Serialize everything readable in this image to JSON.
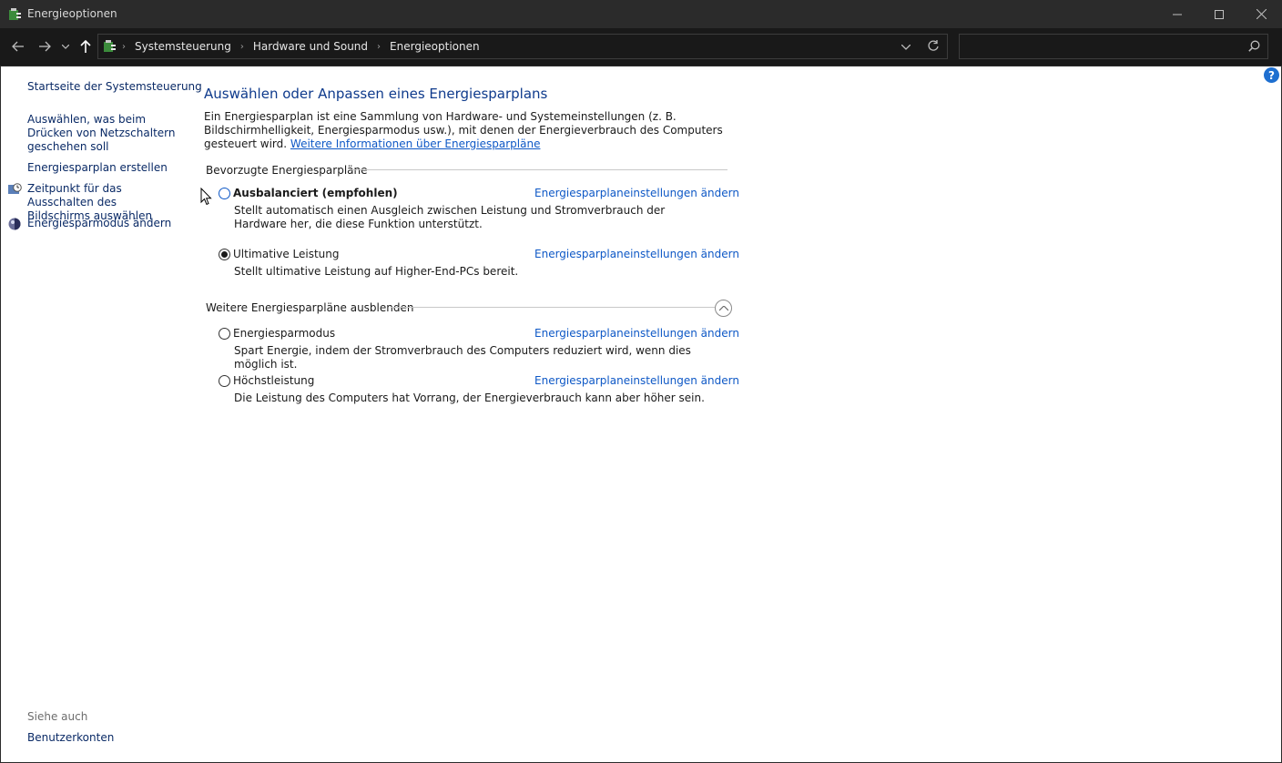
{
  "window": {
    "title": "Energieoptionen"
  },
  "nav": {
    "breadcrumbs": [
      "Systemsteuerung",
      "Hardware und Sound",
      "Energieoptionen"
    ],
    "search_placeholder": ""
  },
  "sidebar": {
    "home_link": "Startseite der Systemsteuerung",
    "links": [
      "Auswählen, was beim Drücken von Netzschaltern geschehen soll",
      "Energiesparplan erstellen",
      "Zeitpunkt für das Ausschalten des Bildschirms auswählen",
      "Energiesparmodus ändern"
    ],
    "see_also_label": "Siehe auch",
    "see_also_links": [
      "Benutzerkonten"
    ]
  },
  "main": {
    "title": "Auswählen oder Anpassen eines Energiesparplans",
    "intro_text": "Ein Energiesparplan ist eine Sammlung von Hardware- und Systemeinstellungen (z. B. Bildschirmhelligkeit, Energiesparmodus usw.), mit denen der Energieverbrauch des Computers gesteuert wird.",
    "intro_link": "Weitere Informationen über Energiesparpläne",
    "preferred_group_label": "Bevorzugte Energiesparpläne",
    "more_group_label": "Weitere Energiesparpläne ausblenden",
    "plans": [
      {
        "name": "Ausbalanciert (empfohlen)",
        "description": "Stellt automatisch einen Ausgleich zwischen Leistung und Stromverbrauch der Hardware her, die diese Funktion unterstützt.",
        "link": "Energiesparplaneinstellungen ändern",
        "selected": false
      },
      {
        "name": "Ultimative Leistung",
        "description": "Stellt ultimative Leistung auf Higher-End-PCs bereit.",
        "link": "Energiesparplaneinstellungen ändern",
        "selected": true
      },
      {
        "name": "Energiesparmodus",
        "description": "Spart Energie, indem der Stromverbrauch des Computers reduziert wird, wenn dies möglich ist.",
        "link": "Energiesparplaneinstellungen ändern",
        "selected": false
      },
      {
        "name": "Höchstleistung",
        "description": "Die Leistung des Computers hat Vorrang, der Energieverbrauch kann aber höher sein.",
        "link": "Energiesparplaneinstellungen ändern",
        "selected": false
      }
    ]
  },
  "colors": {
    "link": "#0e58c6",
    "title": "#0e3a8c",
    "titlebar": "#2b2b2b",
    "addressbar": "#191919"
  },
  "icons": [
    "power-options-icon",
    "back-arrow-icon",
    "forward-arrow-icon",
    "recent-dropdown-icon",
    "up-arrow-icon",
    "address-dropdown-icon",
    "refresh-icon",
    "search-icon",
    "help-icon",
    "clock-icon",
    "energy-saver-icon",
    "collapse-chevron-icon",
    "minimize-icon",
    "maximize-icon",
    "close-icon"
  ]
}
